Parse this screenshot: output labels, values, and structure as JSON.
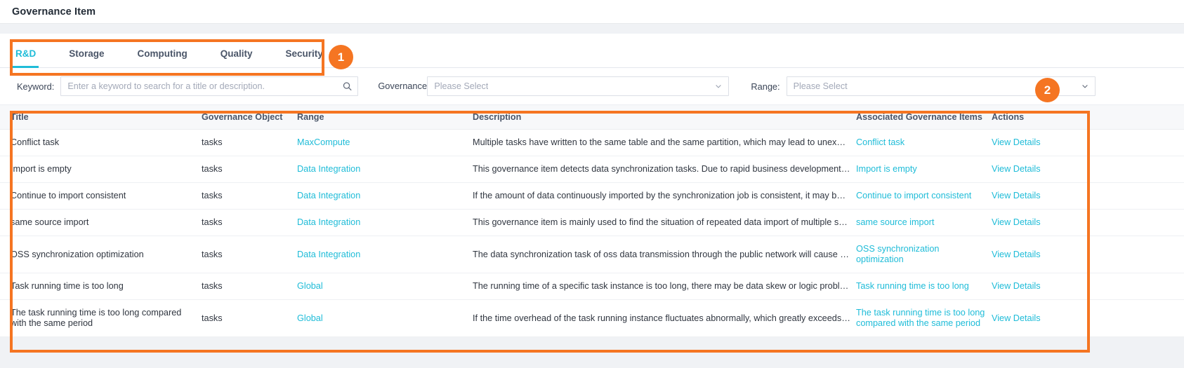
{
  "header": {
    "title": "Governance Item"
  },
  "tabs": [
    {
      "label": "R&D",
      "active": true
    },
    {
      "label": "Storage",
      "active": false
    },
    {
      "label": "Computing",
      "active": false
    },
    {
      "label": "Quality",
      "active": false
    },
    {
      "label": "Security",
      "active": false
    }
  ],
  "filters": {
    "keyword_label": "Keyword:",
    "keyword_placeholder": "Enter a keyword to search for a title or description.",
    "keyword_value": "",
    "search_icon": "search-icon",
    "governance_object_label": "Governance Object",
    "governance_object_placeholder": "Please Select",
    "governance_object_value": "",
    "range_label": "Range:",
    "range_placeholder": "Please Select",
    "range_value": "",
    "dropdown_icon": "chevron-down-icon"
  },
  "table": {
    "columns": [
      "Title",
      "Governance Object",
      "Range",
      "Description",
      "Associated Governance Items",
      "Actions"
    ],
    "action_label": "View Details",
    "rows": [
      {
        "title": "Conflict task",
        "object": "tasks",
        "range": "MaxCompute",
        "description": "Multiple tasks have written to the same table and the same partition, which may lead to unexpecte…",
        "associated": "Conflict task",
        "action": "View Details"
      },
      {
        "title": "Import is empty",
        "object": "tasks",
        "range": "Data Integration",
        "description": "This governance item detects data synchronization tasks. Due to rapid business development, foreg…",
        "associated": "Import is empty",
        "action": "View Details"
      },
      {
        "title": "Continue to import consistent",
        "object": "tasks",
        "range": "Data Integration",
        "description": "If the amount of data continuously imported by the synchronization job is consistent, it may be that…",
        "associated": "Continue to import consistent",
        "action": "View Details"
      },
      {
        "title": "same source import",
        "object": "tasks",
        "range": "Data Integration",
        "description": "This governance item is mainly used to find the situation of repeated data import of multiple synchr…",
        "associated": "same source import",
        "action": "View Details"
      },
      {
        "title": "OSS synchronization optimization",
        "object": "tasks",
        "range": "Data Integration",
        "description": "The data synchronization task of oss data transmission through the public network will cause additi…",
        "associated": "OSS synchronization optimization",
        "action": "View Details"
      },
      {
        "title": "Task running time is too long",
        "object": "tasks",
        "range": "Global",
        "description": "The running time of a specific task instance is too long, there may be data skew or logic problems, …",
        "associated": "Task running time is too long",
        "action": "View Details"
      },
      {
        "title": "The task running time is too long compared with the same period",
        "object": "tasks",
        "range": "Global",
        "description": "If the time overhead of the task running instance fluctuates abnormally, which greatly exceeds the r…",
        "associated": "The task running time is too long compared with the same period",
        "action": "View Details"
      }
    ]
  },
  "annotations": {
    "badge_1": "1",
    "badge_2": "2",
    "accent_color": "#f57522",
    "link_color": "#1fbcd8"
  }
}
